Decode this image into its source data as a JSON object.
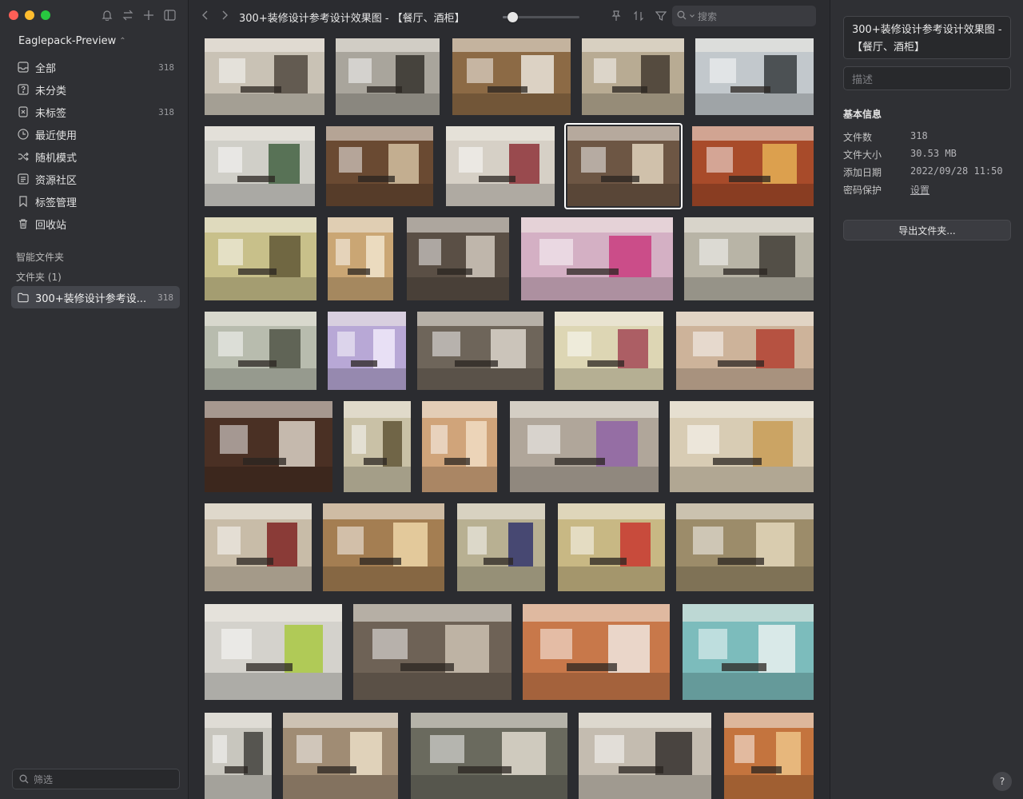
{
  "library": {
    "name": "Eaglepack-Preview",
    "switch_icon": "chevron-updown-icon"
  },
  "sidebar": {
    "tools": [
      "bell-icon",
      "swap-icon",
      "plus-icon",
      "sidebar-toggle-icon"
    ],
    "items": [
      {
        "label": "全部",
        "count": "318",
        "icon": "inbox-icon"
      },
      {
        "label": "未分类",
        "count": "",
        "icon": "question-box-icon"
      },
      {
        "label": "未标签",
        "count": "318",
        "icon": "tag-off-icon"
      },
      {
        "label": "最近使用",
        "count": "",
        "icon": "clock-icon"
      },
      {
        "label": "随机模式",
        "count": "",
        "icon": "shuffle-icon"
      },
      {
        "label": "资源社区",
        "count": "",
        "icon": "community-icon"
      },
      {
        "label": "标签管理",
        "count": "",
        "icon": "bookmark-icon"
      },
      {
        "label": "回收站",
        "count": "",
        "icon": "trash-icon"
      }
    ],
    "smart_folders_label": "智能文件夹",
    "folders_label": "文件夹 (1)",
    "folder": {
      "label": "300+装修设计参考设...",
      "count": "318"
    },
    "filter_placeholder": "筛选"
  },
  "toolbar": {
    "title": "300+装修设计参考设计效果图 - 【餐厅、酒柜】",
    "zoom_level": 0.12,
    "search_placeholder": "搜索"
  },
  "thumbnails": [
    {
      "tone": "#c9c2b5",
      "accent": "#4a4138"
    },
    {
      "tone": "#a9a59c",
      "accent": "#2d2a26"
    },
    {
      "tone": "#8c6a45",
      "accent": "#f0ece4"
    },
    {
      "tone": "#b8ab93",
      "accent": "#3c332a"
    },
    {
      "tone": "#c2c8cc",
      "accent": "#2e3336"
    },
    {
      "tone": "#d0cfc8",
      "accent": "#3a5a3a"
    },
    {
      "tone": "#6a4a32",
      "accent": "#d9c7a8"
    },
    {
      "tone": "#d6d0c6",
      "accent": "#8a2830"
    },
    {
      "tone": "#6d5644",
      "accent": "#e8dcc6"
    },
    {
      "tone": "#a84b2a",
      "accent": "#e8b558"
    },
    {
      "tone": "#c8c08a",
      "accent": "#5a5030"
    },
    {
      "tone": "#caa674",
      "accent": "#f2e8d2"
    },
    {
      "tone": "#5a4f45",
      "accent": "#d8d0c4"
    },
    {
      "tone": "#d4b0c4",
      "accent": "#c8357a"
    },
    {
      "tone": "#b8b4a6",
      "accent": "#3a3630"
    },
    {
      "tone": "#b8bcae",
      "accent": "#4a4e40"
    },
    {
      "tone": "#b8a8d6",
      "accent": "#f4eefc"
    },
    {
      "tone": "#6e655a",
      "accent": "#e2dcd2"
    },
    {
      "tone": "#ddd6b4",
      "accent": "#a04050"
    },
    {
      "tone": "#cdb39a",
      "accent": "#b03a2a"
    },
    {
      "tone": "#4a3024",
      "accent": "#e4dcd0"
    },
    {
      "tone": "#c9c1a6",
      "accent": "#5a4e30"
    },
    {
      "tone": "#d0a47a",
      "accent": "#f2e0c8"
    },
    {
      "tone": "#b0a69a",
      "accent": "#8e60a6"
    },
    {
      "tone": "#d8ccb4",
      "accent": "#c89a50"
    },
    {
      "tone": "#c8bca8",
      "accent": "#7a1a1a"
    },
    {
      "tone": "#a47e52",
      "accent": "#f2dcae"
    },
    {
      "tone": "#b8b092",
      "accent": "#2a2e6a"
    },
    {
      "tone": "#c8b884",
      "accent": "#c8302a"
    },
    {
      "tone": "#9c8c6a",
      "accent": "#e8dcc0"
    },
    {
      "tone": "#d4d2cc",
      "accent": "#a6c83a"
    },
    {
      "tone": "#6e6256",
      "accent": "#d2c8b8"
    },
    {
      "tone": "#c8784a",
      "accent": "#f2eee8"
    },
    {
      "tone": "#7cbcbc",
      "accent": "#f0f4f2"
    },
    {
      "tone": "#c8c6be",
      "accent": "#3a3834"
    },
    {
      "tone": "#a08c74",
      "accent": "#f0e4cc"
    },
    {
      "tone": "#6a6a5e",
      "accent": "#e8e2d6"
    },
    {
      "tone": "#c4bcb0",
      "accent": "#2a2624"
    },
    {
      "tone": "#c4743e",
      "accent": "#f0c88c"
    }
  ],
  "inspector": {
    "title": "300+装修设计参考设计效果图 - 【餐厅、酒柜】",
    "desc_placeholder": "描述",
    "section_title": "基本信息",
    "rows": [
      {
        "key": "文件数",
        "value": "318"
      },
      {
        "key": "文件大小",
        "value": "30.53 MB"
      },
      {
        "key": "添加日期",
        "value": "2022/09/28 11:50"
      },
      {
        "key": "密码保护",
        "value": "设置"
      }
    ],
    "export_label": "导出文件夹...",
    "help_label": "?"
  }
}
